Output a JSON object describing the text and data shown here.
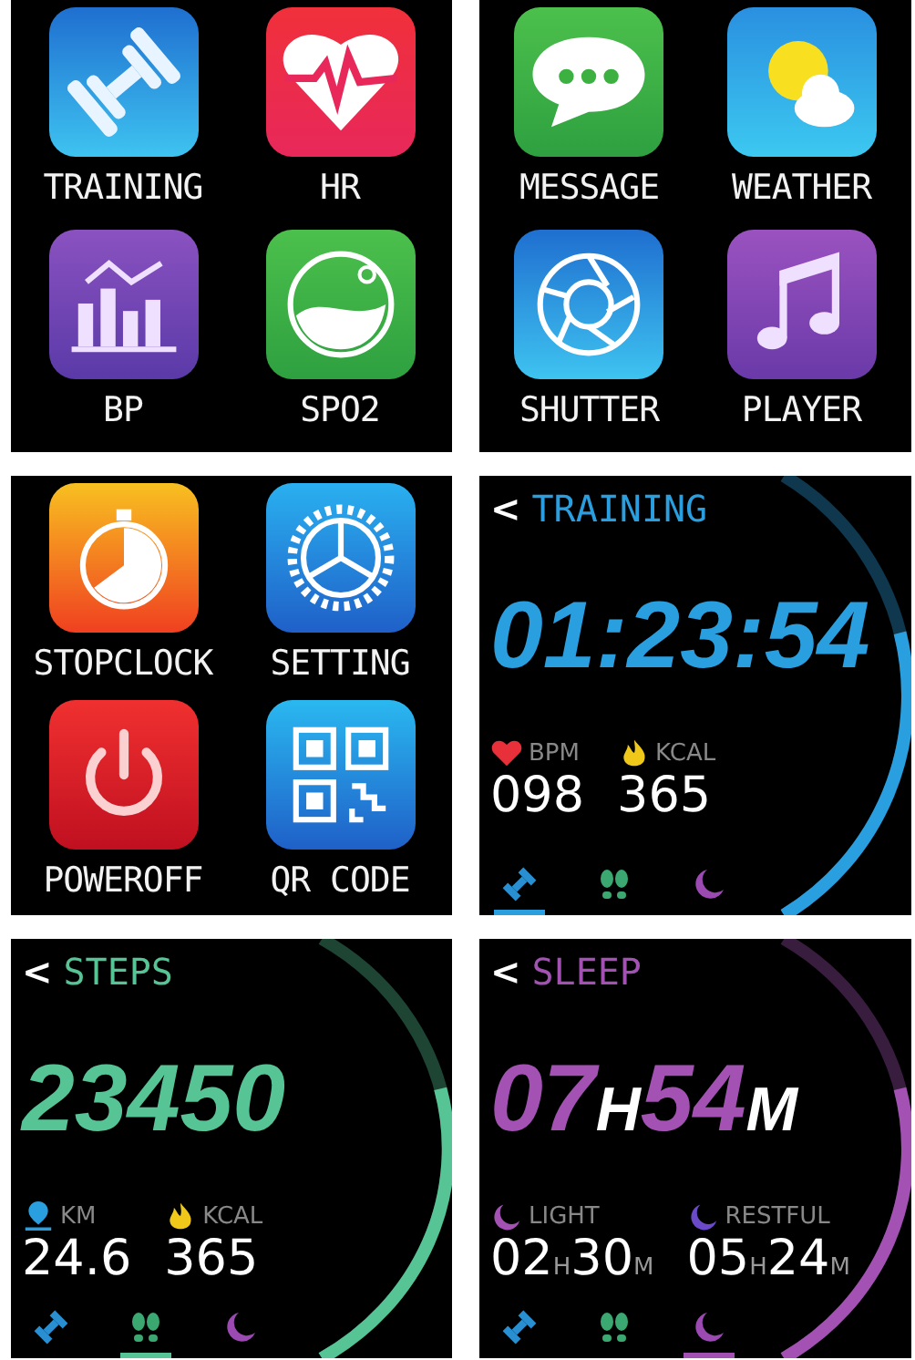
{
  "screens": [
    {
      "kind": "apps",
      "apps": [
        {
          "kind": "training",
          "label": "TRAINING"
        },
        {
          "kind": "hr",
          "label": "HR"
        },
        {
          "kind": "bp",
          "label": "BP"
        },
        {
          "kind": "spo2",
          "label": "SPO2"
        }
      ]
    },
    {
      "kind": "apps",
      "apps": [
        {
          "kind": "message",
          "label": "MESSAGE"
        },
        {
          "kind": "weather",
          "label": "WEATHER"
        },
        {
          "kind": "shutter",
          "label": "SHUTTER"
        },
        {
          "kind": "player",
          "label": "PLAYER"
        }
      ]
    },
    {
      "kind": "apps",
      "apps": [
        {
          "kind": "stopclock",
          "label": "STOPCLOCK"
        },
        {
          "kind": "setting",
          "label": "SETTING"
        },
        {
          "kind": "power",
          "label": "POWEROFF"
        },
        {
          "kind": "qr",
          "label": "QR CODE"
        }
      ]
    },
    {
      "kind": "activity",
      "back": "<",
      "title": "TRAINING",
      "color": "#2a9fe0",
      "level": 0.62,
      "main": [
        {
          "text": "01:23:54",
          "unit": false
        }
      ],
      "stats": [
        {
          "kind": "heart",
          "label": "BPM",
          "value": [
            {
              "text": "098",
              "unit": false
            }
          ]
        },
        {
          "kind": "flame",
          "label": "KCAL",
          "value": [
            {
              "text": "365",
              "unit": false
            }
          ]
        }
      ],
      "nav": [
        {
          "kind": "dumbbell",
          "selected": true
        },
        {
          "kind": "footprints",
          "selected": false
        },
        {
          "kind": "moon",
          "selected": false
        }
      ]
    },
    {
      "kind": "activity",
      "back": "<",
      "title": "STEPS",
      "color": "#56c495",
      "level": 0.62,
      "main": [
        {
          "text": "23450",
          "unit": false
        }
      ],
      "stats": [
        {
          "kind": "pin",
          "label": "KM",
          "value": [
            {
              "text": "24.6",
              "unit": false
            }
          ]
        },
        {
          "kind": "flame",
          "label": "KCAL",
          "value": [
            {
              "text": "365",
              "unit": false
            }
          ]
        }
      ],
      "nav": [
        {
          "kind": "dumbbell",
          "selected": false
        },
        {
          "kind": "footprints",
          "selected": true
        },
        {
          "kind": "moon",
          "selected": false
        }
      ]
    },
    {
      "kind": "activity",
      "back": "<",
      "title": "SLEEP",
      "color": "#a352b4",
      "level": 0.62,
      "main": [
        {
          "text": "07",
          "unit": false
        },
        {
          "text": "H",
          "unit": true
        },
        {
          "text": "54",
          "unit": false
        },
        {
          "text": "M",
          "unit": true
        }
      ],
      "stats": [
        {
          "kind": "moon",
          "color": "#a352b4",
          "label": "LIGHT",
          "value": [
            {
              "text": "02",
              "unit": false
            },
            {
              "text": "H",
              "unit": true
            },
            {
              "text": "30",
              "unit": false
            },
            {
              "text": "M",
              "unit": true
            }
          ]
        },
        {
          "kind": "moon",
          "color": "#6a4ac8",
          "label": "RESTFUL",
          "value": [
            {
              "text": "05",
              "unit": false
            },
            {
              "text": "H",
              "unit": true
            },
            {
              "text": "24",
              "unit": false
            },
            {
              "text": "M",
              "unit": true
            }
          ]
        }
      ],
      "nav": [
        {
          "kind": "dumbbell",
          "selected": false
        },
        {
          "kind": "footprints",
          "selected": false
        },
        {
          "kind": "moon",
          "selected": true
        }
      ]
    }
  ]
}
